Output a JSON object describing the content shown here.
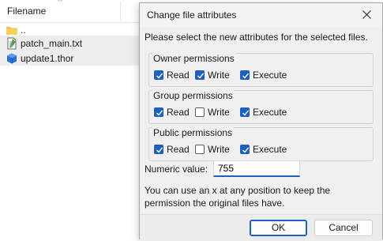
{
  "file_list": {
    "column_header": "Filename",
    "rows": [
      {
        "name": "..",
        "icon": "folder-icon",
        "selected": false
      },
      {
        "name": "patch_main.txt",
        "icon": "text-file-icon",
        "selected": true
      },
      {
        "name": "update1.thor",
        "icon": "package-file-icon",
        "selected": true
      }
    ]
  },
  "dialog": {
    "title": "Change file attributes",
    "instruction": "Please select the new attributes for the selected files.",
    "groups": [
      {
        "title": "Owner permissions",
        "read": "Read",
        "write": "Write",
        "execute": "Execute",
        "read_checked": true,
        "write_checked": true,
        "execute_checked": true
      },
      {
        "title": "Group permissions",
        "read": "Read",
        "write": "Write",
        "execute": "Execute",
        "read_checked": true,
        "write_checked": false,
        "execute_checked": true
      },
      {
        "title": "Public permissions",
        "read": "Read",
        "write": "Write",
        "execute": "Execute",
        "read_checked": true,
        "write_checked": false,
        "execute_checked": true
      }
    ],
    "numeric_label": "Numeric value:",
    "numeric_value": "755",
    "hint": "You can use an x at any position to keep the permission the original files have.",
    "ok_label": "OK",
    "cancel_label": "Cancel"
  },
  "colors": {
    "accent": "#1f5fbf",
    "selection": "#ededed",
    "dialog_bg": "#f0f0f0"
  }
}
